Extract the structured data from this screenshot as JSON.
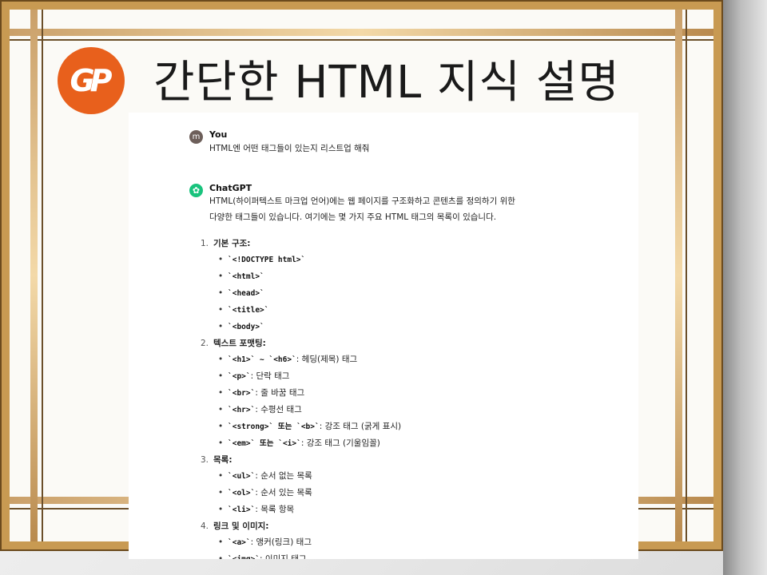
{
  "slide": {
    "logo_text": "GP",
    "title": "간단한 HTML 지식 설명",
    "colors": {
      "frame_gold": "#c89a52",
      "logo_orange": "#e8601c",
      "gpt_green": "#19c37d"
    }
  },
  "chat": {
    "user": {
      "avatar": "m",
      "name": "You",
      "message": "HTML엔 어떤 태그들이 있는지 리스트업 해줘"
    },
    "assistant": {
      "name": "ChatGPT",
      "intro_line1": "HTML(하이퍼텍스트 마크업 언어)에는 웹 페이지를 구조화하고 콘텐츠를 정의하기 위한",
      "intro_line2": "다양한 태그들이 있습니다. 여기에는 몇 가지 주요 HTML 태그의 목록이 있습니다."
    },
    "sections": [
      {
        "number": "1.",
        "title": "기본 구조:",
        "items": [
          {
            "code": "`<!DOCTYPE html>`",
            "desc": ""
          },
          {
            "code": "`<html>`",
            "desc": ""
          },
          {
            "code": "`<head>`",
            "desc": ""
          },
          {
            "code": "`<title>`",
            "desc": ""
          },
          {
            "code": "`<body>`",
            "desc": ""
          }
        ]
      },
      {
        "number": "2.",
        "title": "텍스트 포맷팅:",
        "items": [
          {
            "code": "`<h1>` ~ `<h6>`",
            "desc": ": 헤딩(제목) 태그"
          },
          {
            "code": "`<p>`",
            "desc": ": 단락 태그"
          },
          {
            "code": "`<br>`",
            "desc": ": 줄 바꿈 태그"
          },
          {
            "code": "`<hr>`",
            "desc": ": 수평선 태그"
          },
          {
            "code": "`<strong>` 또는 `<b>`",
            "desc": ": 강조 태그 (굵게 표시)"
          },
          {
            "code": "`<em>` 또는 `<i>`",
            "desc": ": 강조 태그 (기울임꼴)"
          }
        ]
      },
      {
        "number": "3.",
        "title": "목록:",
        "items": [
          {
            "code": "`<ul>`",
            "desc": ": 순서 없는 목록"
          },
          {
            "code": "`<ol>`",
            "desc": ": 순서 있는 목록"
          },
          {
            "code": "`<li>`",
            "desc": ": 목록 항목"
          }
        ]
      },
      {
        "number": "4.",
        "title": "링크 및 이미지:",
        "items": [
          {
            "code": "`<a>`",
            "desc": ": 앵커(링크) 태그"
          },
          {
            "code": "`<img>`",
            "desc": ": 이미지 태그"
          }
        ]
      }
    ]
  }
}
